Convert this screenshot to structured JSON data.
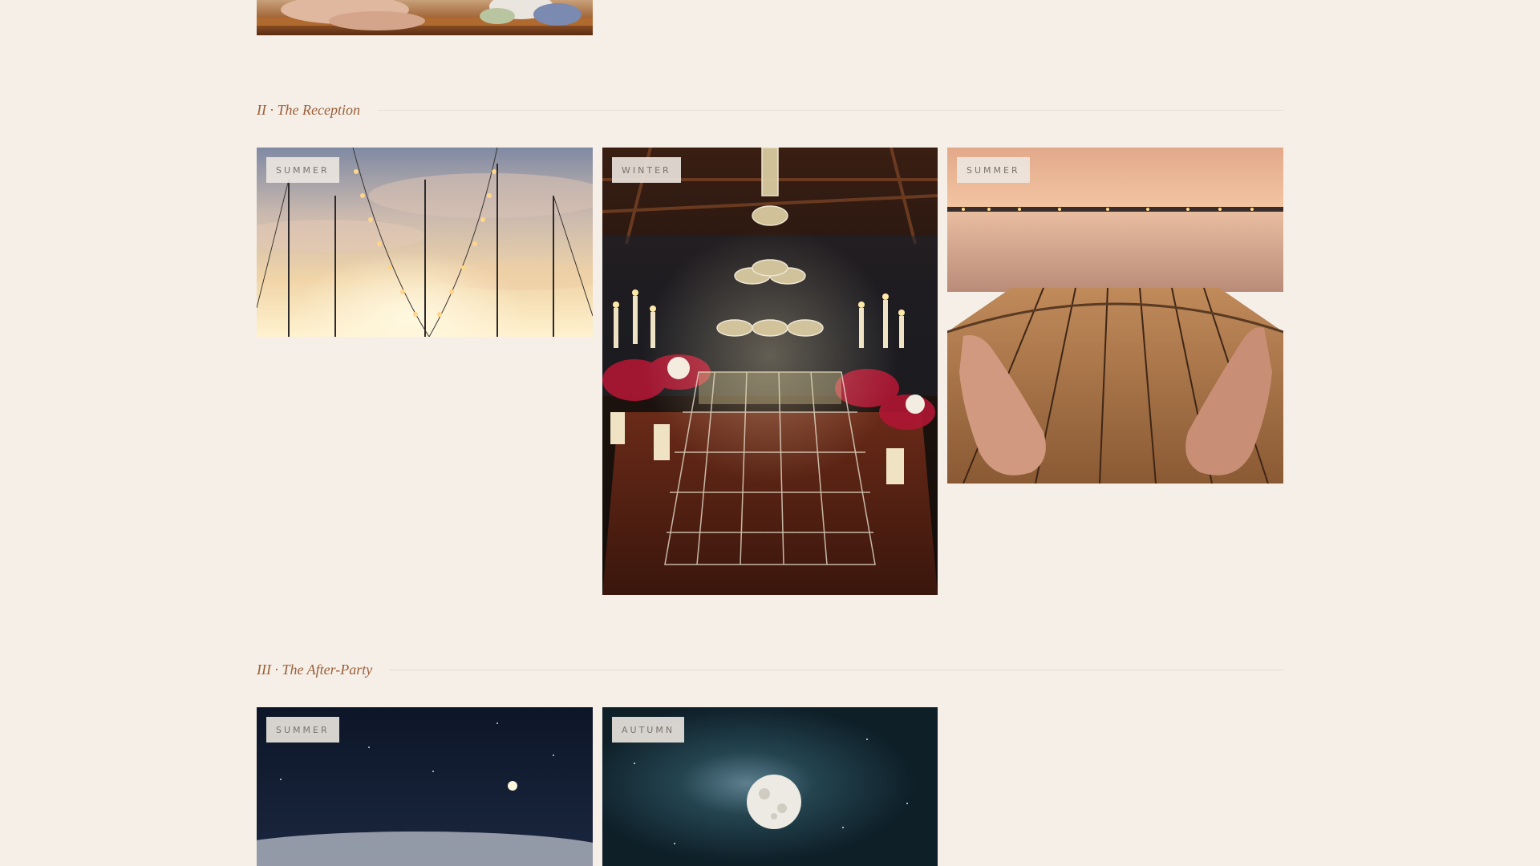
{
  "colors": {
    "background": "#f5efe8",
    "section_title": "#9b5f38",
    "badge_text": "#7a736c",
    "rule": "#e6ddd2"
  },
  "sections": [
    {
      "title": "II · The Reception",
      "photos": [
        {
          "season": "SUMMER",
          "subject": "string lights between sailboat masts at sunset"
        },
        {
          "season": "WINTER",
          "subject": "champagne tower with candles and red roses on a yacht table"
        },
        {
          "season": "SUMMER",
          "subject": "bare feet on a teak deck facing a sunset harbour"
        }
      ]
    },
    {
      "title": "III · The After-Party",
      "photos": [
        {
          "season": "SUMMER",
          "subject": "yacht at night under a crescent moon"
        },
        {
          "season": "AUTUMN",
          "subject": "full moon over dark water"
        }
      ]
    }
  ]
}
